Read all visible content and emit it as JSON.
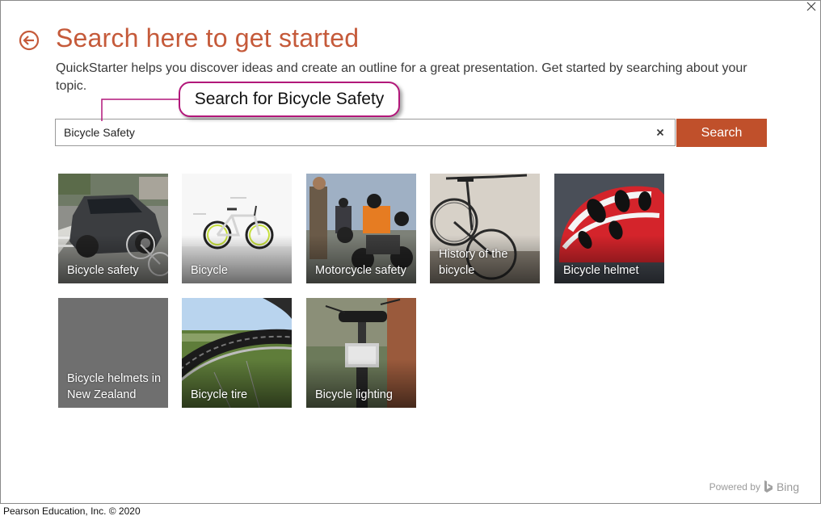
{
  "header": {
    "title": "Search here to get started",
    "description": "QuickStarter helps you discover ideas and create an outline for a great presentation. Get started by searching about your topic."
  },
  "search": {
    "value": "Bicycle Safety",
    "button_label": "Search",
    "clear_symbol": "×"
  },
  "callout": {
    "text": "Search for Bicycle Safety"
  },
  "tiles": [
    {
      "label": "Bicycle safety"
    },
    {
      "label": "Bicycle"
    },
    {
      "label": "Motorcycle safety"
    },
    {
      "label": "History of the bicycle"
    },
    {
      "label": "Bicycle helmet"
    },
    {
      "label": "Bicycle helmets in New Zealand"
    },
    {
      "label": "Bicycle tire"
    },
    {
      "label": "Bicycle lighting"
    }
  ],
  "footer": {
    "powered_by": "Powered by",
    "bing": "Bing",
    "copyright": "Pearson Education, Inc. © 2020"
  },
  "colors": {
    "accent": "#c55a3a",
    "search_button": "#c0502b",
    "callout_border": "#b2177a"
  },
  "icons": [
    "close-icon",
    "back-arrow-icon",
    "clear-icon",
    "bing-logo-icon"
  ]
}
